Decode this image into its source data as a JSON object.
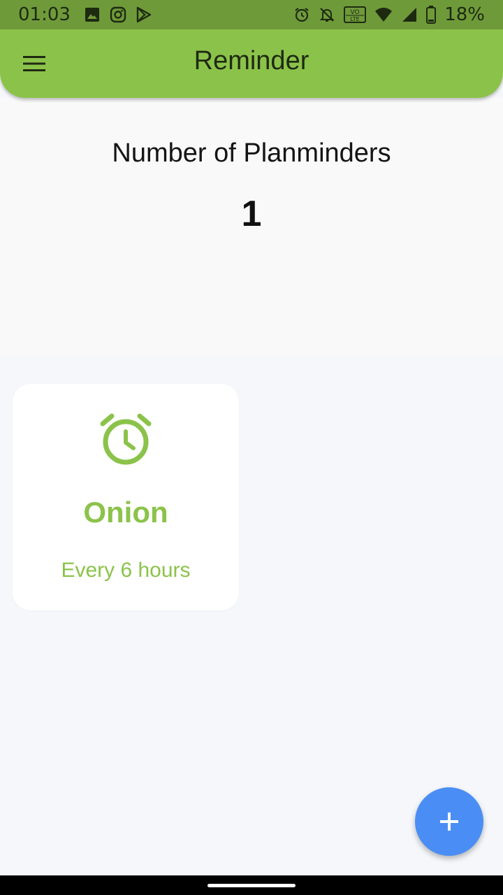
{
  "status_bar": {
    "time": "01:03",
    "battery_percent": "18%",
    "left_icons": [
      "gallery-icon",
      "instagram-icon",
      "play-store-icon"
    ],
    "right_icons": [
      "alarm-icon",
      "notifications-off-icon",
      "volte-icon",
      "wifi-icon",
      "signal-icon",
      "battery-icon"
    ],
    "volte_label_top": "VO",
    "volte_label_bottom": "LTE"
  },
  "app_bar": {
    "title": "Reminder",
    "menu_icon": "hamburger-menu-icon"
  },
  "summary": {
    "label": "Number of Planminders",
    "count": "1"
  },
  "reminders": [
    {
      "icon": "alarm-clock-icon",
      "name": "Onion",
      "frequency": "Every 6 hours"
    }
  ],
  "fab": {
    "icon": "plus-icon"
  },
  "colors": {
    "primary": "#8bc34a",
    "status_bar": "#6f9a3a",
    "fab": "#4a8ef5",
    "background": "#f5f7fb"
  }
}
